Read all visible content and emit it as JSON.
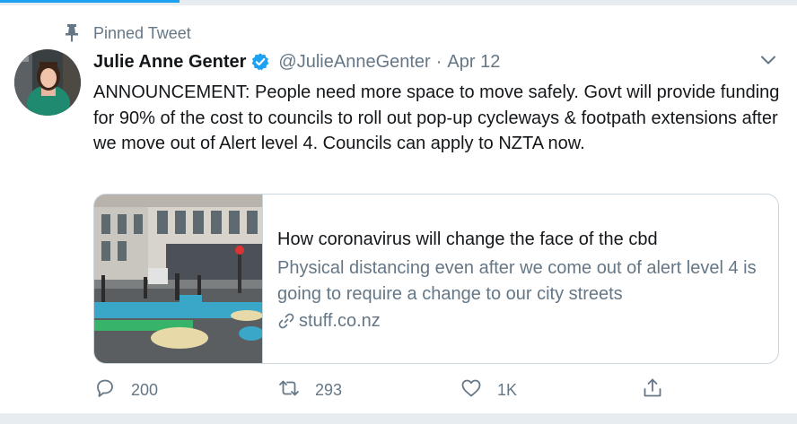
{
  "pinned": {
    "label": "Pinned Tweet"
  },
  "author": {
    "display_name": "Julie Anne Genter",
    "handle": "@JulieAnneGenter",
    "separator": "·",
    "date": "Apr 12",
    "verified": true
  },
  "tweet": {
    "text": "ANNOUNCEMENT: People need more space to move safely. Govt will provide funding for 90% of the cost to councils to roll out pop-up cycleways & footpath extensions after we move out of Alert level 4. Councils can apply to NZTA now."
  },
  "card": {
    "title": "How coronavirus will change the face of the cbd",
    "description": "Physical distancing even after we come out of alert level 4 is going to require a change to our city streets",
    "domain": "stuff.co.nz"
  },
  "actions": {
    "replies": "200",
    "retweets": "293",
    "likes": "1K"
  },
  "colors": {
    "accent": "#1da1f2",
    "secondary_text": "#657786",
    "border": "#ccd6dd"
  },
  "icons": [
    "pin-icon",
    "verified-badge-icon",
    "chevron-down-icon",
    "link-icon",
    "reply-icon",
    "retweet-icon",
    "like-icon",
    "share-icon"
  ]
}
